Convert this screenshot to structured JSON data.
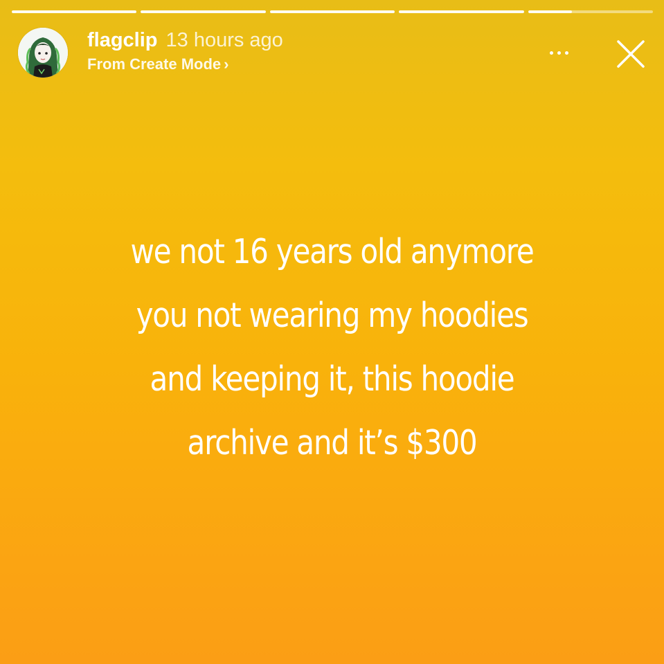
{
  "story": {
    "progress": [
      1,
      1,
      1,
      1,
      0.35
    ],
    "user": {
      "username": "flagclip",
      "time_ago": "13 hours ago",
      "source_label": "From Create Mode",
      "source_chevron": "›"
    },
    "icons": {
      "avatar": "anime-avatar-icon",
      "more": "more-options-icon",
      "close": "close-icon"
    },
    "caption_lines": [
      "we not 16 years old anymore",
      "you not wearing my hoodies",
      "and keeping it, this hoodie",
      "archive and it’s $300"
    ],
    "colors": {
      "background_top": "#e8bd17",
      "background_bottom": "#fb9e15",
      "text": "#ffffff"
    }
  }
}
